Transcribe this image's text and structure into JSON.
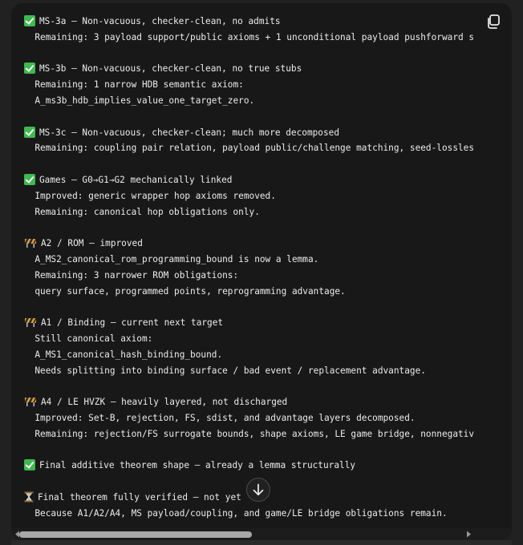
{
  "blocks": [
    {
      "icon": "check-mark-icon",
      "heading": "MS-3a — Non-vacuous, checker-clean, no admits",
      "lines": [
        "Remaining: 3 payload support/public axioms + 1 unconditional payload pushforward s"
      ]
    },
    {
      "icon": "check-mark-icon",
      "heading": "MS-3b — Non-vacuous, checker-clean, no true stubs",
      "lines": [
        "Remaining: 1 narrow HDB semantic axiom:",
        "A_ms3b_hdb_implies_value_one_target_zero."
      ]
    },
    {
      "icon": "check-mark-icon",
      "heading": "MS-3c — Non-vacuous, checker-clean; much more decomposed",
      "lines": [
        "Remaining: coupling pair relation, payload public/challenge matching, seed-lossles"
      ]
    },
    {
      "icon": "check-mark-icon",
      "heading": "Games — G0→G1→G2 mechanically linked",
      "lines": [
        "Improved: generic wrapper hop axioms removed.",
        "Remaining: canonical hop obligations only."
      ]
    },
    {
      "icon": "construction-barrier-icon",
      "heading": "A2 / ROM — improved",
      "lines": [
        "A_MS2_canonical_rom_programming_bound is now a lemma.",
        "Remaining: 3 narrower ROM obligations:",
        "query surface, programmed points, reprogramming advantage."
      ]
    },
    {
      "icon": "construction-barrier-icon",
      "heading": "A1 / Binding — current next target",
      "lines": [
        "Still canonical axiom:",
        "A_MS1_canonical_hash_binding_bound.",
        "Needs splitting into binding surface / bad event / replacement advantage."
      ]
    },
    {
      "icon": "construction-barrier-icon",
      "heading": "A4 / LE HVZK — heavily layered, not discharged",
      "lines": [
        "Improved: Set-B, rejection, FS, sdist, and advantage layers decomposed.",
        "Remaining: rejection/FS surrogate bounds, shape axioms, LE game bridge, nonnegativ"
      ]
    },
    {
      "icon": "check-mark-icon",
      "heading": "Final additive theorem shape — already a lemma structurally",
      "lines": []
    },
    {
      "icon": "hourglass-icon",
      "heading": "Final theorem fully verified — not yet",
      "lines": [
        "Because A1/A2/A4, MS payload/coupling, and game/LE bridge obligations remain."
      ]
    }
  ],
  "icons": {
    "copy": "copy-icon",
    "scroll_down": "arrow-down-icon",
    "scroll_left": "triangle-left-icon",
    "scroll_right": "triangle-right-icon"
  },
  "colors": {
    "check": "#3fb950",
    "barrier_orange": "#e8a33d",
    "hourglass": "#d9b36c",
    "panel_bg": "#181818",
    "page_bg": "#212121",
    "text": "#ececec"
  }
}
